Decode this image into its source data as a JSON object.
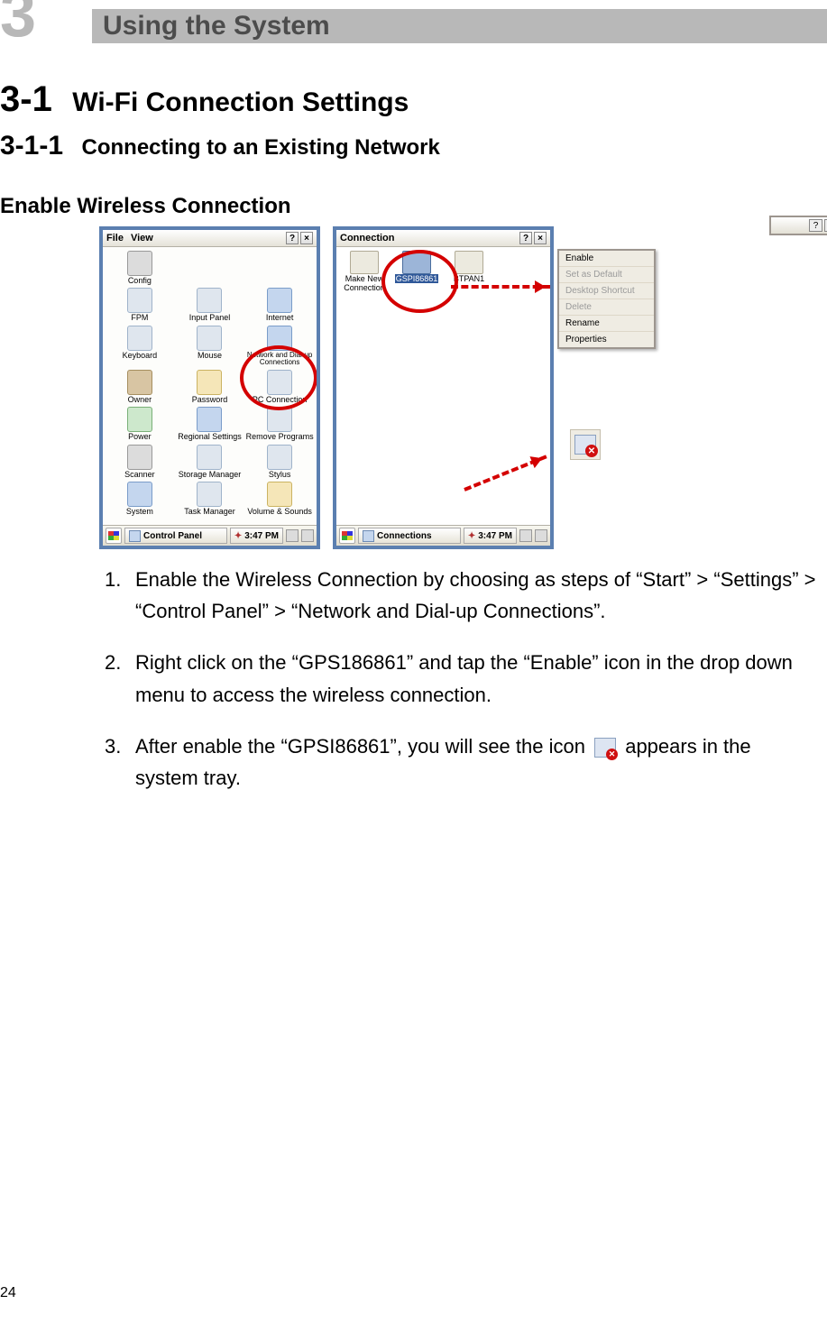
{
  "chapter": {
    "num": "3",
    "title": "Using the System"
  },
  "section": {
    "num": "3-1",
    "title": "Wi-Fi Connection Settings"
  },
  "subsection": {
    "num": "3-1-1",
    "title": "Connecting to an Existing Network"
  },
  "h3": "Enable Wireless Connection",
  "screen1": {
    "menu": {
      "file": "File",
      "view": "View"
    },
    "help": "?",
    "close": "×",
    "items": [
      "Config",
      "",
      "",
      "FPM",
      "Input Panel",
      "Internet",
      "Keyboard",
      "Mouse",
      "Network and Dial-up Connections",
      "Owner",
      "Password",
      "PC Connection",
      "Power",
      "Regional Settings",
      "Remove Programs",
      "Scanner",
      "Storage Manager",
      "Stylus",
      "System",
      "Task Manager",
      "Volume & Sounds"
    ],
    "taskbar": {
      "app": "Control Panel",
      "time": "3:47 PM"
    }
  },
  "screen2": {
    "title": "Connection",
    "help": "?",
    "close": "×",
    "items": {
      "make": "Make New Connection",
      "sel": "GSPI86861",
      "bt": "BTPAN1"
    },
    "taskbar": {
      "app": "Connections",
      "time": "3:47 PM"
    }
  },
  "menu": {
    "enable": "Enable",
    "setdefault": "Set as Default",
    "shortcut": "Desktop Shortcut",
    "delete": "Delete",
    "rename": "Rename",
    "properties": "Properties"
  },
  "list": {
    "i1": {
      "n": "1.",
      "t": "Enable the Wireless Connection by choosing as steps of “Start” > “Settings” > “Control Panel” > “Network and Dial-up Connections”."
    },
    "i2": {
      "n": "2.",
      "t": "Right click on the “GPS186861” and tap the “Enable” icon in the drop down menu to access the wireless connection."
    },
    "i3": {
      "n": "3.",
      "ta": "After enable the “GPSI86861”, you will see the icon",
      "tb": "appears in the system tray."
    }
  },
  "page": "24"
}
